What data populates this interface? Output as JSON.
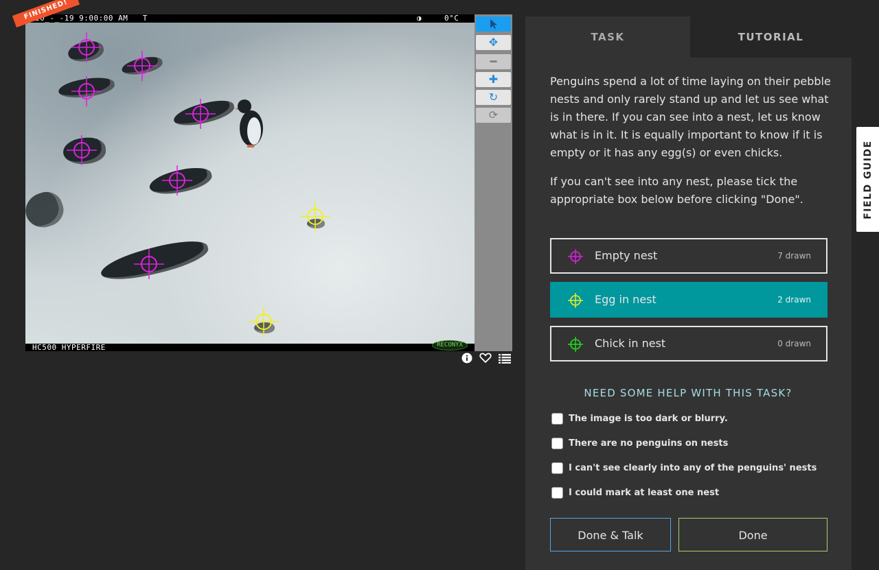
{
  "subject": {
    "ribbon_text": "FINISHED!",
    "camera_timestamp": "20_-_-19 9:00:00 AM   T",
    "moon": "◑",
    "temperature": "0°C",
    "camera_model": "HC500 HYPERFIRE",
    "camera_brand": "RECONYX",
    "marks": [
      {
        "tool": "Empty nest"
      },
      {
        "tool": "Empty nest"
      },
      {
        "tool": "Empty nest"
      },
      {
        "tool": "Empty nest"
      },
      {
        "tool": "Empty nest"
      },
      {
        "tool": "Empty nest"
      },
      {
        "tool": "Empty nest"
      },
      {
        "tool": "Egg in nest"
      },
      {
        "tool": "Egg in nest"
      }
    ]
  },
  "toolbar": {
    "tools": [
      {
        "icon": "pointer-icon",
        "state": "active"
      },
      {
        "icon": "move-icon",
        "state": "normal"
      },
      {
        "icon": "zoom-out-icon",
        "state": "disabled"
      },
      {
        "icon": "zoom-in-icon",
        "state": "normal"
      },
      {
        "icon": "rotate-icon",
        "state": "normal"
      },
      {
        "icon": "reset-icon",
        "state": "disabled"
      }
    ],
    "subject_icons": [
      "info-icon",
      "heart-icon",
      "collections-icon"
    ]
  },
  "tabs": {
    "task": "TASK",
    "tutorial": "TUTORIAL"
  },
  "instructions": {
    "paragraph1": "Penguins spend a lot of time laying on their pebble nests and only rarely stand up and let us see what is in there. If you can see into a nest, let us know what is in it. It is equally important to know if it is empty or it has any egg(s) or even chicks.",
    "paragraph2": "If you can't see into any nest, please tick the appropriate box below before clicking \"Done\"."
  },
  "choices": [
    {
      "label": "Empty nest",
      "count": "7 drawn",
      "color": "#e020e0",
      "selected": false
    },
    {
      "label": "Egg in nest",
      "count": "2 drawn",
      "color": "#f0f020",
      "selected": true
    },
    {
      "label": "Chick in nest",
      "count": "0 drawn",
      "color": "#20e020",
      "selected": false
    }
  ],
  "help": {
    "title": "NEED SOME HELP WITH THIS TASK?",
    "checkboxes": [
      {
        "label": "The image is too dark or blurry.",
        "checked": false
      },
      {
        "label": "There are no penguins on nests",
        "checked": false
      },
      {
        "label": "I can't see clearly into any of the penguins' nests",
        "checked": false
      },
      {
        "label": "I could mark at least one nest",
        "checked": false
      }
    ]
  },
  "buttons": {
    "done_talk": "Done & Talk",
    "done": "Done"
  },
  "field_guide": "FIELD GUIDE",
  "colors": {
    "empty_nest": "#e020e0",
    "egg_in_nest": "#f0f020",
    "chick_in_nest": "#20e020",
    "selected_choice": "#00979d",
    "ribbon": "#f0532b",
    "active_tool": "#1a9ef0"
  }
}
